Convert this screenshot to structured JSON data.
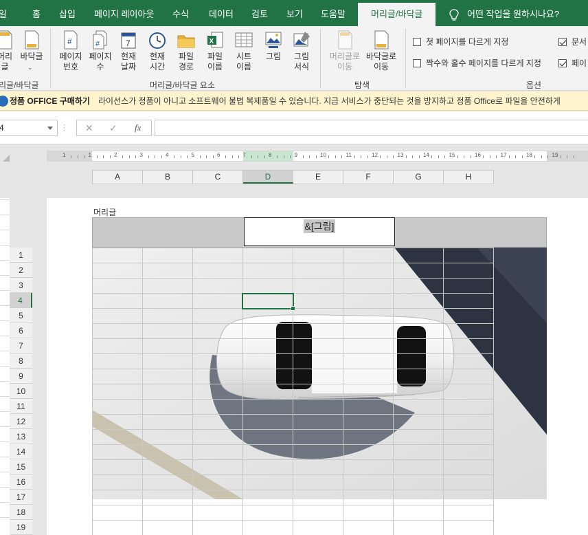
{
  "ribbon_tabs": [
    "일",
    "홈",
    "삽입",
    "페이지 레이아웃",
    "수식",
    "데이터",
    "검토",
    "보기",
    "도움말",
    "머리글/바닥글"
  ],
  "tell_me": "어떤 작업을 원하시나요?",
  "groups": {
    "header_footer": {
      "label": "리글/바닥글",
      "header_btn": "머리글",
      "footer_btn": "바닥글"
    },
    "elements": {
      "label": "머리글/바닥글 요소",
      "buttons": [
        {
          "line1": "페이지",
          "line2": "번호",
          "icon": "page-number-icon"
        },
        {
          "line1": "페이지",
          "line2": "수",
          "icon": "page-count-icon"
        },
        {
          "line1": "현재",
          "line2": "날짜",
          "icon": "calendar-icon"
        },
        {
          "line1": "현재",
          "line2": "시간",
          "icon": "clock-icon"
        },
        {
          "line1": "파일",
          "line2": "경로",
          "icon": "folder-icon"
        },
        {
          "line1": "파일",
          "line2": "이름",
          "icon": "excel-file-icon"
        },
        {
          "line1": "시트",
          "line2": "이름",
          "icon": "sheet-icon"
        },
        {
          "line1": "그림",
          "line2": "",
          "icon": "picture-icon"
        },
        {
          "line1": "그림",
          "line2": "서식",
          "icon": "format-picture-icon"
        }
      ]
    },
    "navigation": {
      "label": "탐색",
      "goto_header": {
        "line1": "머리글로",
        "line2": "이동"
      },
      "goto_footer": {
        "line1": "바닥글로",
        "line2": "이동"
      }
    },
    "options": {
      "label": "옵션",
      "different_first": "첫 페이지를 다르게 지정",
      "different_odd_even": "짝수와 홀수 페이지를 다르게 지정",
      "scale_with_doc": "문서",
      "align_margins": "페이"
    }
  },
  "message_bar": {
    "title": "정품 OFFICE 구매하기",
    "text": "라이선스가 정품이 아니고 소프트웨어 불법 복제품일 수 있습니다. 지금 서비스가 중단되는 것을 방지하고 정품 Office로 파일을 안전하게"
  },
  "formula_bar": {
    "name_box": "4",
    "cancel": "✕",
    "enter": "✓",
    "fx": "fx",
    "content": ""
  },
  "ruler_numbers": [
    "1",
    "1",
    "2",
    "3",
    "4",
    "5",
    "6",
    "7",
    "8",
    "9",
    "10",
    "11",
    "12",
    "13",
    "14",
    "15",
    "16",
    "17",
    "18",
    "19"
  ],
  "columns": [
    "A",
    "B",
    "C",
    "D",
    "E",
    "F",
    "G",
    "H"
  ],
  "selected_column": "D",
  "rows": [
    "1",
    "2",
    "3",
    "4",
    "5",
    "6",
    "7",
    "8",
    "9",
    "10",
    "11",
    "12",
    "13",
    "14",
    "15",
    "16",
    "17",
    "18",
    "19"
  ],
  "selected_row": "4",
  "header_area": {
    "label": "머리글",
    "center_code": "&[그림]"
  },
  "colors": {
    "excel_green": "#217346",
    "message_bg": "#fff4ce"
  }
}
